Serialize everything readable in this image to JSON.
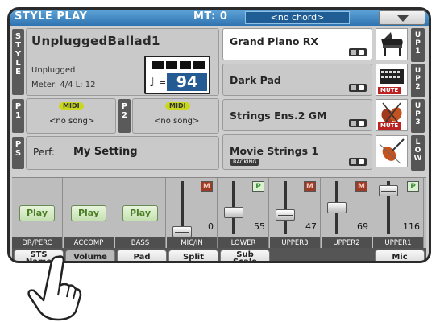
{
  "header": {
    "title": "STYLE PLAY",
    "mt": "MT: 0",
    "chord": "<no chord>"
  },
  "side_tabs": {
    "style": "S T Y L E",
    "p1": "P 1",
    "p2": "P 2",
    "ps": "P S"
  },
  "style": {
    "name": "UnpluggedBallad1",
    "category": "Unplugged",
    "meter": "Meter: 4/4  L: 12",
    "tempo_note": "♩",
    "tempo_eq": "=",
    "tempo": "94"
  },
  "players": {
    "p1_badge": "MIDI",
    "p1_song": "<no song>",
    "p2_badge": "MIDI",
    "p2_song": "<no song>"
  },
  "performance": {
    "label": "Perf:",
    "value": "My Setting"
  },
  "sounds": [
    {
      "name": "Grand Piano RX",
      "tab": "U P 1",
      "tag": ""
    },
    {
      "name": "Dark Pad",
      "tab": "U P 2",
      "tag": "MUTE"
    },
    {
      "name": "Strings Ens.2 GM",
      "tab": "U P 3",
      "tag": "MUTE"
    },
    {
      "name": "Movie Strings 1",
      "tab": "L O W",
      "tag": "BACKING"
    }
  ],
  "mixer": {
    "play_label": "Play",
    "channels": [
      {
        "label": "DR/PERC",
        "type": "play"
      },
      {
        "label": "ACCOMP",
        "type": "play"
      },
      {
        "label": "BASS",
        "type": "play"
      },
      {
        "label": "MIC/IN",
        "type": "fader",
        "value": "0",
        "level": 0.0,
        "badge": "M"
      },
      {
        "label": "LOWER",
        "type": "fader",
        "value": "55",
        "level": 0.43,
        "badge": "P"
      },
      {
        "label": "UPPER3",
        "type": "fader",
        "value": "47",
        "level": 0.37,
        "badge": "M"
      },
      {
        "label": "UPPER2",
        "type": "fader",
        "value": "69",
        "level": 0.54,
        "badge": "M"
      },
      {
        "label": "UPPER1",
        "type": "fader",
        "value": "116",
        "level": 0.91,
        "badge": "P"
      }
    ]
  },
  "tabs": [
    {
      "line1": "STS",
      "line2": "Name"
    },
    {
      "line1": "Volume",
      "line2": ""
    },
    {
      "line1": "Pad",
      "line2": ""
    },
    {
      "line1": "Split",
      "line2": ""
    },
    {
      "line1": "Sub",
      "line2": "Scale"
    },
    {
      "line1": "Mic",
      "line2": ""
    }
  ],
  "colors": {
    "title_bar": "#2f73b0",
    "tempo_box": "#245b93",
    "midi_badge": "#c9d71e",
    "mute_badge": "#9e3b26",
    "play_text": "#4b7d25"
  }
}
